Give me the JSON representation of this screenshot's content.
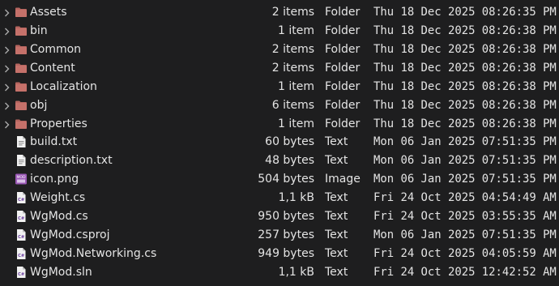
{
  "colors": {
    "background": "#1e1e1f",
    "text": "#e4e4e4",
    "folder": "#b5655f",
    "file": "#f2f2f2",
    "cs_badge": "#f2f2f2",
    "png_icon": "#9b59b6",
    "chevron": "#aaaaaa"
  },
  "files": [
    {
      "name": "Assets",
      "size": "2 items",
      "type": "Folder",
      "modified": "Thu 18 Dec 2025 08:26:35 PM",
      "icon": "folder-icon",
      "expandable": true
    },
    {
      "name": "bin",
      "size": "1 item",
      "type": "Folder",
      "modified": "Thu 18 Dec 2025 08:26:38 PM",
      "icon": "folder-icon",
      "expandable": true
    },
    {
      "name": "Common",
      "size": "2 items",
      "type": "Folder",
      "modified": "Thu 18 Dec 2025 08:26:38 PM",
      "icon": "folder-icon",
      "expandable": true
    },
    {
      "name": "Content",
      "size": "2 items",
      "type": "Folder",
      "modified": "Thu 18 Dec 2025 08:26:38 PM",
      "icon": "folder-icon",
      "expandable": true
    },
    {
      "name": "Localization",
      "size": "1 item",
      "type": "Folder",
      "modified": "Thu 18 Dec 2025 08:26:38 PM",
      "icon": "folder-icon",
      "expandable": true
    },
    {
      "name": "obj",
      "size": "6 items",
      "type": "Folder",
      "modified": "Thu 18 Dec 2025 08:26:38 PM",
      "icon": "folder-icon",
      "expandable": true
    },
    {
      "name": "Properties",
      "size": "1 item",
      "type": "Folder",
      "modified": "Thu 18 Dec 2025 08:26:38 PM",
      "icon": "folder-icon",
      "expandable": true
    },
    {
      "name": "build.txt",
      "size": "60 bytes",
      "type": "Text",
      "modified": "Mon 06 Jan 2025 07:51:35 PM",
      "icon": "text-file-icon",
      "expandable": false
    },
    {
      "name": "description.txt",
      "size": "48 bytes",
      "type": "Text",
      "modified": "Mon 06 Jan 2025 07:51:35 PM",
      "icon": "text-file-icon",
      "expandable": false
    },
    {
      "name": "icon.png",
      "size": "504 bytes",
      "type": "Image",
      "modified": "Mon 06 Jan 2025 07:51:35 PM",
      "icon": "image-file-icon",
      "expandable": false
    },
    {
      "name": "Weight.cs",
      "size": "1,1 kB",
      "type": "Text",
      "modified": "Fri 24 Oct 2025 04:54:49 AM",
      "icon": "csharp-file-icon",
      "expandable": false
    },
    {
      "name": "WgMod.cs",
      "size": "950 bytes",
      "type": "Text",
      "modified": "Fri 24 Oct 2025 03:55:35 AM",
      "icon": "csharp-file-icon",
      "expandable": false
    },
    {
      "name": "WgMod.csproj",
      "size": "257 bytes",
      "type": "Text",
      "modified": "Mon 06 Jan 2025 07:51:35 PM",
      "icon": "csharp-file-icon",
      "expandable": false
    },
    {
      "name": "WgMod.Networking.cs",
      "size": "949 bytes",
      "type": "Text",
      "modified": "Fri 24 Oct 2025 04:05:59 AM",
      "icon": "csharp-file-icon",
      "expandable": false
    },
    {
      "name": "WgMod.sln",
      "size": "1,1 kB",
      "type": "Text",
      "modified": "Fri 24 Oct 2025 12:42:52 AM",
      "icon": "csharp-file-icon",
      "expandable": false
    }
  ]
}
